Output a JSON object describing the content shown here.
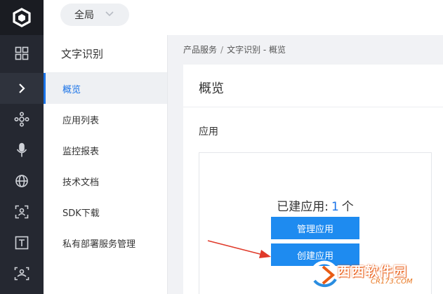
{
  "topbar": {
    "scope_label": "全局"
  },
  "sidebar": {
    "product_title": "文字识别",
    "items": [
      {
        "label": "概览",
        "active": true
      },
      {
        "label": "应用列表"
      },
      {
        "label": "监控报表"
      },
      {
        "label": "技术文档"
      },
      {
        "label": "SDK下载"
      },
      {
        "label": "私有部署服务管理"
      }
    ]
  },
  "breadcrumb": {
    "root": "产品服务",
    "separator": "/",
    "current": "文字识别 - 概览"
  },
  "main": {
    "page_title": "概览",
    "section_title": "应用",
    "count_prefix": "已建应用:",
    "count_value": "1",
    "count_unit": "个",
    "manage_button": "管理应用",
    "create_button": "创建应用"
  },
  "watermark": {
    "text": "西西软件园",
    "url": "CR173.COM"
  },
  "colors": {
    "accent": "#1a73e8",
    "button": "#1e8bf0",
    "rail": "#252831",
    "annotation": "#e03a2a"
  },
  "rail_icons": [
    "logo-icon",
    "grid-icon",
    "chevron-right-icon",
    "nodes-icon",
    "microphone-icon",
    "globe-icon",
    "face-scan-icon",
    "text-icon",
    "image-scan-icon"
  ]
}
